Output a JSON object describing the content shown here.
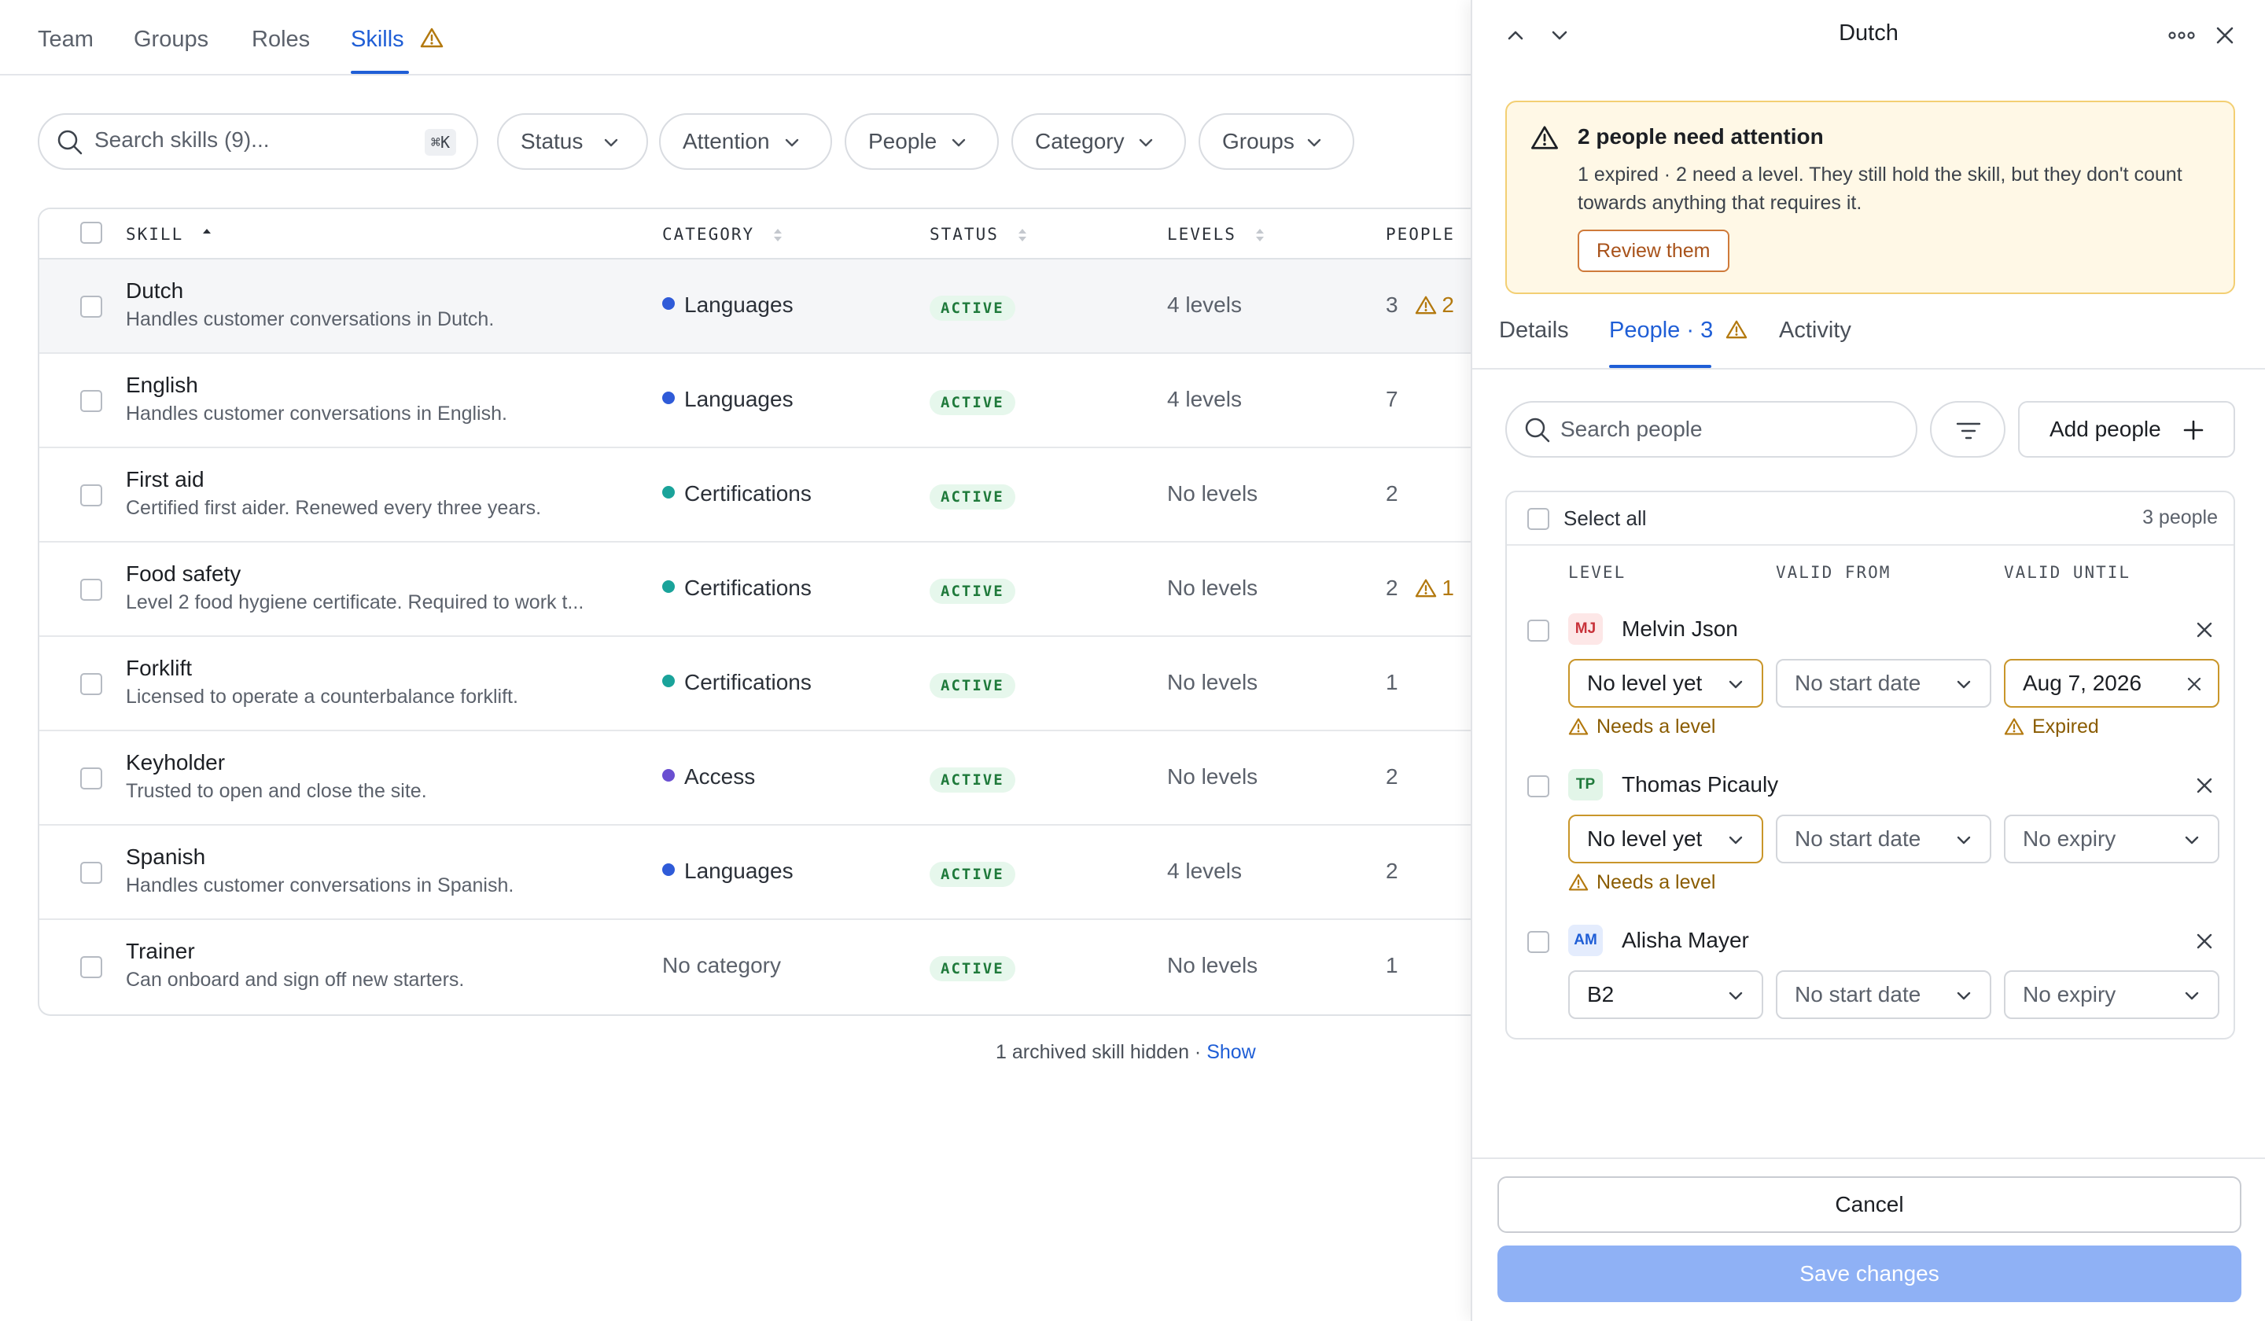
{
  "nav": {
    "tabs": [
      {
        "label": "Team"
      },
      {
        "label": "Groups"
      },
      {
        "label": "Roles"
      },
      {
        "label": "Skills"
      }
    ],
    "active_tab": "Skills"
  },
  "toolbar": {
    "search_placeholder": "Search skills (9)...",
    "shortcut": "⌘K",
    "filters": [
      "Status",
      "Attention",
      "People",
      "Category",
      "Groups"
    ]
  },
  "table": {
    "columns": [
      "SKILL",
      "CATEGORY",
      "STATUS",
      "LEVELS",
      "PEOPLE"
    ],
    "rows": [
      {
        "name": "Dutch",
        "desc": "Handles customer conversations in Dutch.",
        "category": "Languages",
        "category_color": "#2f5bd8",
        "status": "ACTIVE",
        "levels": "4 levels",
        "people": "3",
        "attention": "2",
        "selected": true
      },
      {
        "name": "English",
        "desc": "Handles customer conversations in English.",
        "category": "Languages",
        "category_color": "#2f5bd8",
        "status": "ACTIVE",
        "levels": "4 levels",
        "people": "7",
        "attention": ""
      },
      {
        "name": "First aid",
        "desc": "Certified first aider. Renewed every three years.",
        "category": "Certifications",
        "category_color": "#1aa39a",
        "status": "ACTIVE",
        "levels": "No levels",
        "people": "2",
        "attention": ""
      },
      {
        "name": "Food safety",
        "desc": "Level 2 food hygiene certificate. Required to work t...",
        "category": "Certifications",
        "category_color": "#1aa39a",
        "status": "ACTIVE",
        "levels": "No levels",
        "people": "2",
        "attention": "1"
      },
      {
        "name": "Forklift",
        "desc": "Licensed to operate a counterbalance forklift.",
        "category": "Certifications",
        "category_color": "#1aa39a",
        "status": "ACTIVE",
        "levels": "No levels",
        "people": "1",
        "attention": ""
      },
      {
        "name": "Keyholder",
        "desc": "Trusted to open and close the site.",
        "category": "Access",
        "category_color": "#6a4fd1",
        "status": "ACTIVE",
        "levels": "No levels",
        "people": "2",
        "attention": ""
      },
      {
        "name": "Spanish",
        "desc": "Handles customer conversations in Spanish.",
        "category": "Languages",
        "category_color": "#2f5bd8",
        "status": "ACTIVE",
        "levels": "4 levels",
        "people": "2",
        "attention": ""
      },
      {
        "name": "Trainer",
        "desc": "Can onboard and sign off new starters.",
        "category": "No category",
        "category_color": "",
        "status": "ACTIVE",
        "levels": "No levels",
        "people": "1",
        "attention": ""
      }
    ]
  },
  "footer_note": {
    "text": "1 archived skill hidden · ",
    "link": "Show"
  },
  "panel": {
    "title": "Dutch",
    "alert": {
      "title": "2 people need attention",
      "body": "1 expired · 2 need a level. They still hold the skill, but they don't count towards anything that requires it.",
      "button": "Review them"
    },
    "tabs": [
      {
        "label": "Details"
      },
      {
        "label": "People · 3"
      },
      {
        "label": "Activity"
      }
    ],
    "search_placeholder": "Search people",
    "add_button": "Add people",
    "select_all": "Select all",
    "people_count": "3 people",
    "columns": [
      "LEVEL",
      "VALID FROM",
      "VALID UNTIL"
    ],
    "people": [
      {
        "initials": "MJ",
        "name": "Melvin Json",
        "level": "No level yet",
        "valid_from": "No start date",
        "valid_until": "Aug 7, 2026",
        "level_hint": "Needs a level",
        "until_hint": "Expired"
      },
      {
        "initials": "TP",
        "name": "Thomas Picauly",
        "level": "No level yet",
        "valid_from": "No start date",
        "valid_until": "No expiry",
        "level_hint": "Needs a level",
        "until_hint": ""
      },
      {
        "initials": "AM",
        "name": "Alisha Mayer",
        "level": "B2",
        "valid_from": "No start date",
        "valid_until": "No expiry",
        "level_hint": "",
        "until_hint": ""
      }
    ],
    "cancel": "Cancel",
    "save": "Save changes"
  },
  "colors": {
    "accent": "#1f5ed6",
    "warning": "#b3790f",
    "active_badge_bg": "#e6f7ec",
    "active_badge_text": "#1f7a3b"
  }
}
